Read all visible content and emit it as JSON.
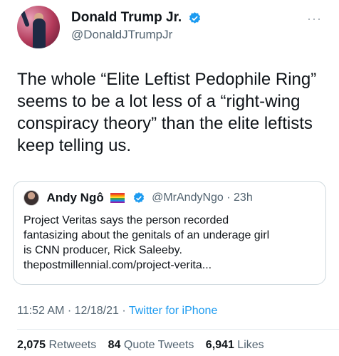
{
  "author": {
    "display_name": "Donald Trump Jr.",
    "handle": "@DonaldJTrumpJr",
    "verified_icon": "verified-badge",
    "more_icon": "more-options"
  },
  "tweet": {
    "text": "The whole “Elite Leftist Pedophile Ring” seems to be a lot less of a “right-wing conspiracy theory” than the elite leftists keep telling us."
  },
  "quote": {
    "name": "Andy Ngô",
    "flag_icon": "rainbow-flag",
    "handle_time": "@MrAndyNgo · 23h",
    "text_lines": [
      "Project Veritas says the person recorded",
      "fantasizing about the genitals of an underage girl",
      "is CNN producer, Rick Saleeby.",
      "thepostmillennial.com/project-verita..."
    ]
  },
  "meta": {
    "time_date": "11:52 AM · 12/18/21 · ",
    "source": "Twitter for iPhone"
  },
  "stats": {
    "retweets_count": "2,075",
    "retweets_label": "Retweets",
    "quote_count": "84",
    "quote_label": "Quote Tweets",
    "likes_count": "6,941",
    "likes_label": "Likes"
  },
  "colors": {
    "accent": "#1d9bf0",
    "secondary_text": "#536471",
    "border": "#cfd9de"
  }
}
